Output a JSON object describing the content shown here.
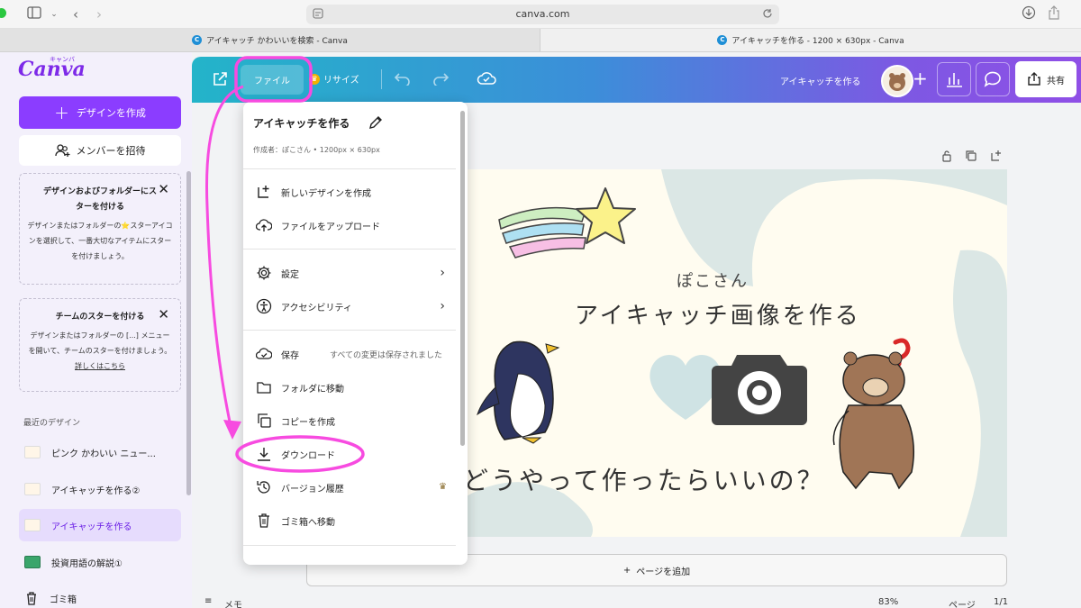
{
  "browser": {
    "url": "canva.com",
    "tabs": [
      {
        "label": "アイキャッチ かわいいを検索 - Canva"
      },
      {
        "label": "アイキャッチを作る - 1200 × 630px - Canva"
      }
    ]
  },
  "sidebar": {
    "logo": "Canva",
    "logo_kana": "キャンバ",
    "create_label": "デザインを作成",
    "invite_label": "メンバーを招待",
    "tip1": {
      "title": "デザインおよびフォルダーにスターを付ける",
      "body": "デザインまたはフォルダーの⭐スターアイコンを選択して、一番大切なアイテムにスターを付けましょう。"
    },
    "tip2": {
      "title": "チームのスターを付ける",
      "body": "デザインまたはフォルダーの [...] メニューを開いて、チームのスターを付けましょう。",
      "link": "詳しくはこちら"
    },
    "recent_heading": "最近のデザイン",
    "recent": [
      {
        "label": "ピンク かわいい ニュー..."
      },
      {
        "label": "アイキャッチを作る②"
      },
      {
        "label": "アイキャッチを作る"
      },
      {
        "label": "投資用語の解説①"
      }
    ],
    "trash_label": "ゴミ箱"
  },
  "toolbar": {
    "file_label": "ファイル",
    "resize_label": "リサイズ",
    "design_title": "アイキャッチを作る",
    "share_label": "共有"
  },
  "menu": {
    "title": "アイキャッチを作る",
    "subtitle": "作成者：ぽこさん • 1200px × 630px",
    "items": {
      "new_design": "新しいデザインを作成",
      "upload": "ファイルをアップロード",
      "settings": "設定",
      "accessibility": "アクセシビリティ",
      "save": "保存",
      "save_status": "すべての変更は保存されました",
      "move_folder": "フォルダに移動",
      "copy": "コピーを作成",
      "download": "ダウンロード",
      "history": "バージョン履歴",
      "trash": "ゴミ箱へ移動"
    }
  },
  "design": {
    "name": "ぽこさん",
    "title": "アイキャッチ画像を作る",
    "question": "どうやって作ったらいいの？"
  },
  "canvas": {
    "add_page": "ページを追加",
    "memo": "メモ",
    "zoom": "83%",
    "page_label": "ページ",
    "page_count": "1/1"
  },
  "colors": {
    "accent": "#8b3dff",
    "annotation": "#f74be0"
  }
}
